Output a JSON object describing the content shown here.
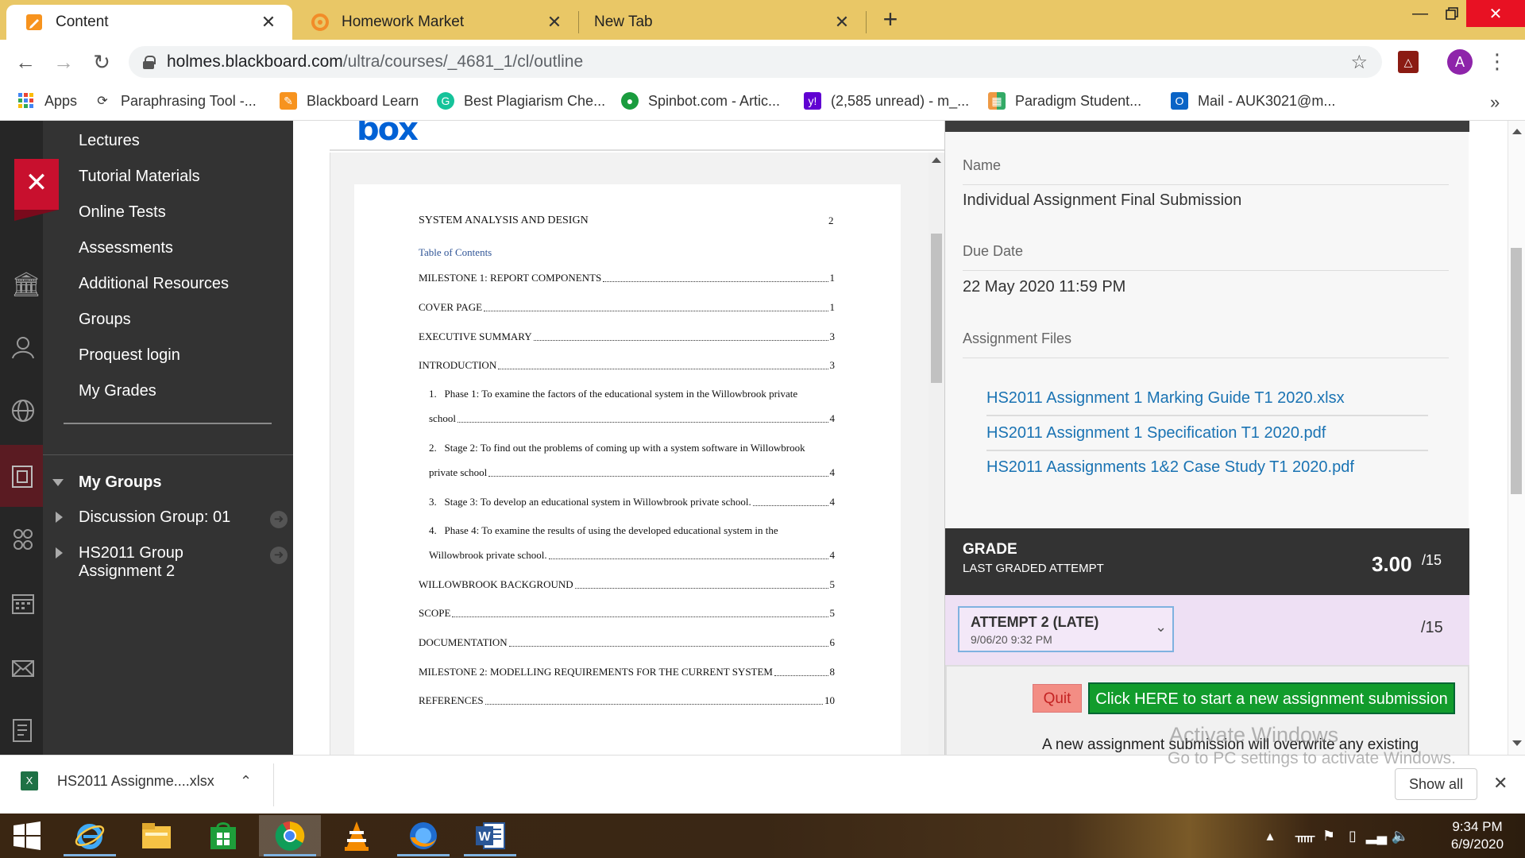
{
  "browser": {
    "tabs": [
      {
        "title": "Content",
        "active": true,
        "favicon": "pencil-icon"
      },
      {
        "title": "Homework Market",
        "active": false,
        "favicon": "homework-icon"
      },
      {
        "title": "New Tab",
        "active": false,
        "favicon": ""
      }
    ],
    "url_host": "holmes.blackboard.com",
    "url_path": "/ultra/courses/_4681_1/cl/outline",
    "profile_initial": "A",
    "bookmarks": [
      {
        "label": "Apps",
        "icon": "apps-grid-icon"
      },
      {
        "label": "Paraphrasing Tool -...",
        "icon": "paraphrase-icon"
      },
      {
        "label": "Blackboard Learn",
        "icon": "pencil-icon"
      },
      {
        "label": "Best Plagiarism Che...",
        "icon": "grammarly-icon"
      },
      {
        "label": "Spinbot.com - Artic...",
        "icon": "spinbot-icon"
      },
      {
        "label": "(2,585 unread) - m_...",
        "icon": "yahoo-icon"
      },
      {
        "label": "Paradigm Student...",
        "icon": "paradigm-icon"
      },
      {
        "label": "Mail - AUK3021@m...",
        "icon": "outlook-icon"
      }
    ]
  },
  "course_nav": {
    "items": [
      "Lectures",
      "Tutorial Materials",
      "Online Tests",
      "Assessments",
      "Additional Resources",
      "Groups",
      "Proquest login",
      "My Grades"
    ],
    "groups_heading": "My Groups",
    "groups": [
      "Discussion Group: 01",
      "HS2011 Group Assignment 2"
    ]
  },
  "document": {
    "running_head": "SYSTEM ANALYSIS AND DESIGN",
    "page_number": "2",
    "toc_title": "Table of Contents",
    "toc": [
      {
        "text": "MILESTONE 1: REPORT COMPONENTS",
        "page": "1"
      },
      {
        "text": "COVER PAGE",
        "page": "1"
      },
      {
        "text": "EXECUTIVE SUMMARY",
        "page": "3"
      },
      {
        "text": "INTRODUCTION",
        "page": "3"
      },
      {
        "num": "1.",
        "line1": "Phase 1: To examine the factors of the educational system in the Willowbrook private",
        "line2": "school",
        "page": "4"
      },
      {
        "num": "2.",
        "line1": "Stage 2: To find out the problems of coming up with a system software in Willowbrook",
        "line2": "private school",
        "page": "4"
      },
      {
        "num": "3.",
        "line1": "Stage 3: To develop an educational system in Willowbrook private school.",
        "line2": "",
        "page": "4"
      },
      {
        "num": "4.",
        "line1": "Phase 4: To examine the results of using the developed educational system in the",
        "line2": "Willowbrook private school.",
        "page": "4"
      },
      {
        "text": "WILLOWBROOK BACKGROUND",
        "page": "5"
      },
      {
        "text": "SCOPE",
        "page": "5"
      },
      {
        "text": "DOCUMENTATION",
        "page": "6"
      },
      {
        "text": "MILESTONE 2: MODELLING REQUIREMENTS FOR THE CURRENT SYSTEM",
        "page": "8"
      },
      {
        "text": "REFERENCES",
        "page": "10"
      }
    ]
  },
  "details": {
    "name_label": "Name",
    "name_value": "Individual Assignment Final Submission",
    "due_label": "Due Date",
    "due_value": "22 May 2020 11:59 PM",
    "files_label": "Assignment Files",
    "files": [
      "HS2011 Assignment 1 Marking Guide T1 2020.xlsx",
      "HS2011 Assignment 1 Specification T1 2020.pdf",
      "HS2011 Aassignments 1&2 Case Study T1 2020.pdf"
    ],
    "grade_title": "GRADE",
    "grade_sub": "LAST GRADED ATTEMPT",
    "grade_value": "3.00",
    "grade_out_of": "/15",
    "attempt_label": "ATTEMPT 2 (LATE)",
    "attempt_date": "9/06/20 9:32 PM",
    "attempt_out_of": "/15",
    "quit_label": "Quit",
    "start_label": "Click HERE to start a new assignment submission",
    "overwrite_note": "A new assignment submission will overwrite any existing"
  },
  "watermark": {
    "line1": "Activate Windows",
    "line2": "Go to PC settings to activate Windows."
  },
  "downloads": {
    "file": "HS2011 Assignme....xlsx",
    "show_all": "Show all"
  },
  "taskbar": {
    "apps": [
      "internet-explorer-icon",
      "file-explorer-icon",
      "store-icon",
      "chrome-icon",
      "vlc-icon",
      "firefox-icon",
      "word-icon"
    ],
    "time": "9:34 PM",
    "date": "6/9/2020"
  },
  "colors": {
    "tabstrip": "#e9c766",
    "blackboard_red": "#c8102e",
    "start_button": "#129c2c",
    "link_blue": "#1a73b3",
    "attempt_bg": "#eee0f4"
  }
}
